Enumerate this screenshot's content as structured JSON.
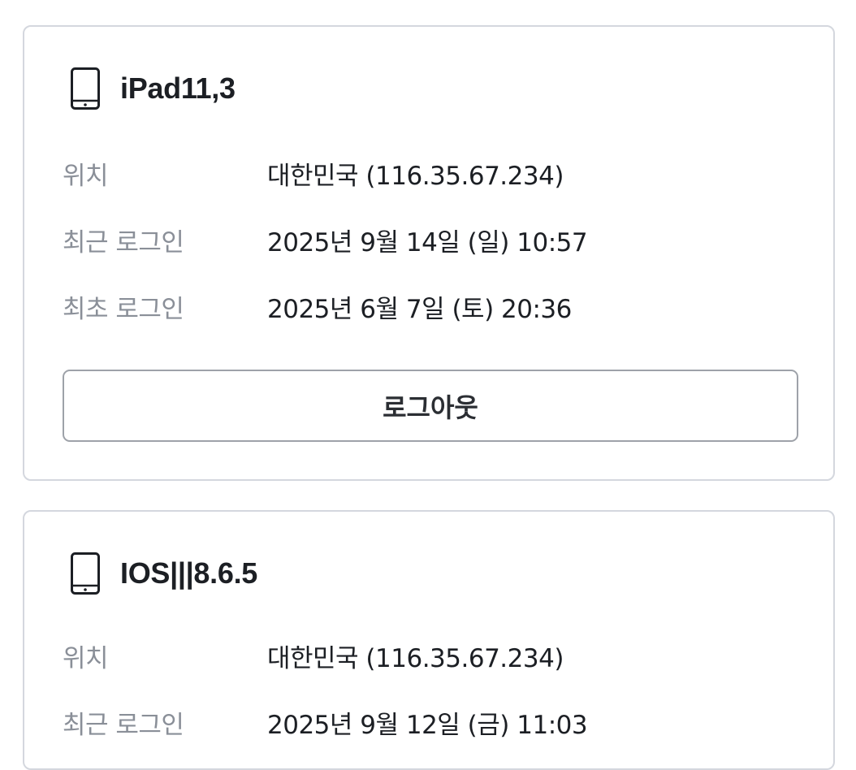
{
  "sessions": [
    {
      "device_icon": "tablet-icon",
      "device_name": "iPad11,3",
      "rows": [
        {
          "label": "위치",
          "value": "대한민국 (116.35.67.234)"
        },
        {
          "label": "최근 로그인",
          "value": "2025년 9월 14일 (일) 10:57"
        },
        {
          "label": "최초 로그인",
          "value": "2025년 6월 7일 (토) 20:36"
        }
      ],
      "logout_label": "로그아웃"
    },
    {
      "device_icon": "tablet-icon",
      "device_name": "IOS|||8.6.5",
      "rows": [
        {
          "label": "위치",
          "value": "대한민국 (116.35.67.234)"
        },
        {
          "label": "최근 로그인",
          "value": "2025년 9월 12일 (금) 11:03"
        }
      ]
    }
  ],
  "colors": {
    "card_border": "#d4d7de",
    "label_text": "#8a8f98",
    "value_text": "#1c1f24",
    "button_border": "#9ea2a9"
  }
}
